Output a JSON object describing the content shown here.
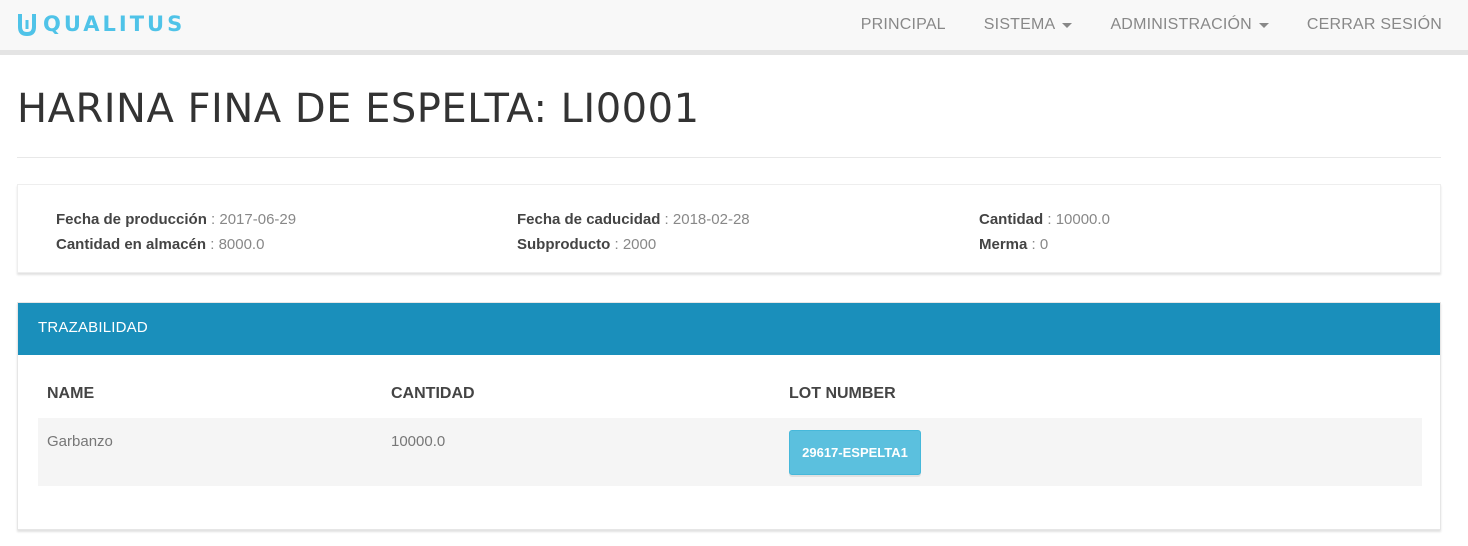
{
  "brand": {
    "name": "QUALITUS",
    "color": "#4fc3e8",
    "icon": "qualitus-logo-icon"
  },
  "nav": {
    "items": [
      {
        "label": "PRINCIPAL",
        "dropdown": false
      },
      {
        "label": "SISTEMA",
        "dropdown": true
      },
      {
        "label": "ADMINISTRACIÓN",
        "dropdown": true
      },
      {
        "label": "CERRAR SESIÓN",
        "dropdown": false
      }
    ]
  },
  "page": {
    "title": "HARINA FINA DE ESPELTA: LI0001"
  },
  "details": {
    "fecha_produccion": {
      "label": "Fecha de producción",
      "value": "2017-06-29"
    },
    "cantidad_almacen": {
      "label": "Cantidad en almacén",
      "value": "8000.0"
    },
    "fecha_caducidad": {
      "label": "Fecha de caducidad",
      "value": "2018-02-28"
    },
    "subproducto": {
      "label": "Subproducto",
      "value": "2000"
    },
    "cantidad": {
      "label": "Cantidad",
      "value": "10000.0"
    },
    "merma": {
      "label": "Merma",
      "value": "0"
    },
    "separator": " : "
  },
  "traceability": {
    "header": "TRAZABILIDAD",
    "header_color": "#1a8fbb",
    "columns": [
      "NAME",
      "CANTIDAD",
      "LOT NUMBER"
    ],
    "rows": [
      {
        "name": "Garbanzo",
        "cantidad": "10000.0",
        "lot_number": "29617-ESPELTA1"
      }
    ],
    "lot_button_color": "#5bc0de"
  }
}
